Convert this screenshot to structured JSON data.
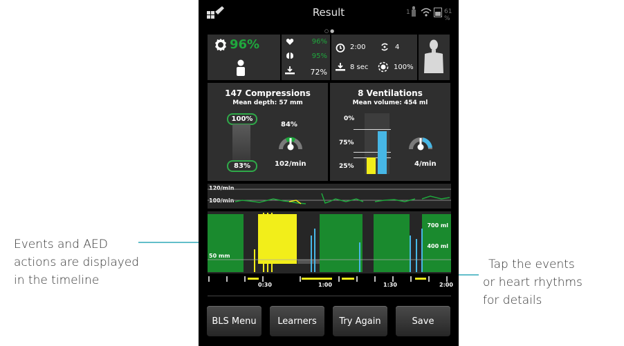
{
  "screen": {
    "title": "Result",
    "signal_count": "1",
    "battery": "61 %"
  },
  "summary": {
    "total_score": "96%",
    "compression_score": "96%",
    "ventilation_score": "95%",
    "flow_score": "72%",
    "duration": "2:00",
    "cycles": "4",
    "hands_off_time": "8 sec",
    "recoil": "100%"
  },
  "compressions": {
    "title": "147 Compressions",
    "subtitle": "Mean depth: 57 mm",
    "depth_top": "100%",
    "depth_bottom": "83%",
    "rate_percent": "84%",
    "rate": "102/min"
  },
  "ventilations": {
    "title": "8 Ventilations",
    "subtitle": "Mean volume: 454 ml",
    "level_top": "0%",
    "level_mid": "75%",
    "level_low": "25%",
    "rate": "4/min"
  },
  "timeline": {
    "rate_high": "120/min",
    "rate_low": "100/min",
    "vol_high": "700 ml",
    "vol_low": "400 ml",
    "depth": "50 mm",
    "ticks": [
      "0:30",
      "1:00",
      "1:30",
      "2:00"
    ]
  },
  "buttons": {
    "bls_menu": "BLS Menu",
    "learners": "Learners",
    "try_again": "Try Again",
    "save": "Save"
  },
  "callouts": {
    "left_line1": "Events and AED",
    "left_line2": "actions are displayed",
    "left_line3": "in the timeline",
    "right_line1": "Tap the events",
    "right_line2": "or heart rhythms",
    "right_line3": "for details"
  },
  "colors": {
    "green": "#1fa83d",
    "yellow": "#f2ee1a",
    "blue": "#47b7e6",
    "callout_line": "#2ea8b8"
  }
}
